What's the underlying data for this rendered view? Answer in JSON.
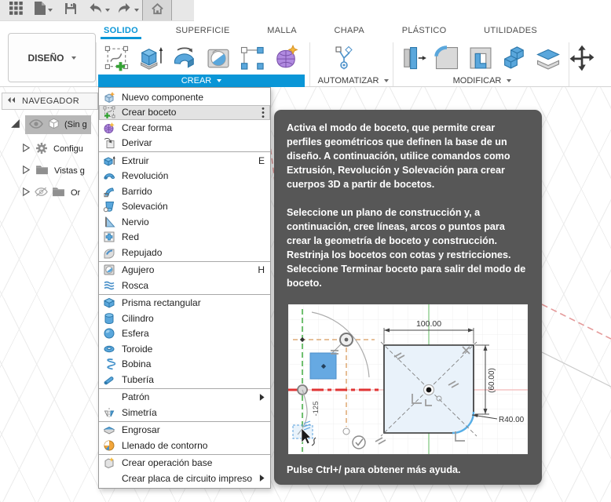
{
  "topbar": {
    "icons": [
      "app-grid",
      "file",
      "save",
      "undo",
      "redo",
      "home"
    ]
  },
  "ribbon": {
    "design_menu": {
      "label": "DISEÑO"
    },
    "tabs": [
      {
        "id": "solido",
        "label": "SOLIDO",
        "active": true
      },
      {
        "id": "superficie",
        "label": "SUPERFICIE",
        "active": false
      },
      {
        "id": "malla",
        "label": "MALLA",
        "active": false
      },
      {
        "id": "chapa",
        "label": "CHAPA",
        "active": false
      },
      {
        "id": "plastico",
        "label": "PLÁSTICO",
        "active": false
      },
      {
        "id": "utilidades",
        "label": "UTILIDADES",
        "active": false
      }
    ],
    "groups": {
      "crear": {
        "label": "CREAR"
      },
      "automatizar": {
        "label": "AUTOMATIZAR"
      },
      "modificar": {
        "label": "MODIFICAR"
      }
    },
    "tools": {
      "crear": [
        "create-sketch",
        "extrude",
        "revolve",
        "hole",
        "pattern",
        "create-form"
      ],
      "automatizar": [
        "scripts"
      ],
      "modificar": [
        "press-pull",
        "fillet",
        "shell",
        "combine",
        "split-body",
        "move-copy"
      ]
    }
  },
  "navigator": {
    "title": "NAVEGADOR",
    "items": [
      {
        "id": "document",
        "label": "(Sin g",
        "selected": true,
        "expanded": true
      },
      {
        "id": "configuracion",
        "label": "Configu",
        "selected": false
      },
      {
        "id": "vistas",
        "label": "Vistas g",
        "selected": false
      },
      {
        "id": "origen",
        "label": "Or",
        "selected": false
      }
    ]
  },
  "menu": {
    "items": [
      {
        "id": "nuevo-componente",
        "label": "Nuevo componente",
        "icon": "new-component"
      },
      {
        "id": "crear-boceto",
        "label": "Crear boceto",
        "icon": "sketch",
        "selected": true,
        "trailing": "kebab"
      },
      {
        "id": "crear-forma",
        "label": "Crear forma",
        "icon": "form"
      },
      {
        "id": "derivar",
        "label": "Derivar",
        "icon": "derive"
      },
      {
        "type": "separator"
      },
      {
        "id": "extruir",
        "label": "Extruir",
        "icon": "extrude-s",
        "shortcut": "E"
      },
      {
        "id": "revolucion",
        "label": "Revolución",
        "icon": "revolve-s"
      },
      {
        "id": "barrido",
        "label": "Barrido",
        "icon": "sweep"
      },
      {
        "id": "solevacion",
        "label": "Solevación",
        "icon": "loft"
      },
      {
        "id": "nervio",
        "label": "Nervio",
        "icon": "rib"
      },
      {
        "id": "red",
        "label": "Red",
        "icon": "web"
      },
      {
        "id": "repujado",
        "label": "Repujado",
        "icon": "emboss"
      },
      {
        "type": "separator"
      },
      {
        "id": "agujero",
        "label": "Agujero",
        "icon": "hole-s",
        "shortcut": "H"
      },
      {
        "id": "rosca",
        "label": "Rosca",
        "icon": "thread"
      },
      {
        "type": "separator"
      },
      {
        "id": "prisma-rectangular",
        "label": "Prisma rectangular",
        "icon": "box"
      },
      {
        "id": "cilindro",
        "label": "Cilindro",
        "icon": "cylinder"
      },
      {
        "id": "esfera",
        "label": "Esfera",
        "icon": "sphere"
      },
      {
        "id": "toroide",
        "label": "Toroide",
        "icon": "torus"
      },
      {
        "id": "bobina",
        "label": "Bobina",
        "icon": "coil"
      },
      {
        "id": "tuberia",
        "label": "Tubería",
        "icon": "pipe"
      },
      {
        "type": "separator"
      },
      {
        "id": "patron",
        "label": "Patrón",
        "submenu": true
      },
      {
        "id": "simetria",
        "label": "Simetría",
        "icon": "mirror"
      },
      {
        "type": "separator"
      },
      {
        "id": "engrosar",
        "label": "Engrosar",
        "icon": "thicken"
      },
      {
        "id": "llenado-de-contorno",
        "label": "Llenado de contorno",
        "icon": "boundary-fill"
      },
      {
        "type": "separator"
      },
      {
        "id": "crear-operacion-base",
        "label": "Crear operación base",
        "icon": "base-feature"
      },
      {
        "id": "crear-placa-de-circuito-impreso",
        "label": "Crear placa de circuito impreso",
        "submenu": true
      }
    ]
  },
  "tooltip": {
    "paragraphs": [
      "Activa el modo de boceto, que permite crear perfiles geométricos que definen la base de un diseño. A continuación, utilice comandos como Extrusión, Revolución y Solevación para crear cuerpos 3D a partir de bocetos.",
      "Seleccione un plano de construcción y, a continuación, cree líneas, arcos o puntos para crear la geometría de boceto y construcción. Restrinja los bocetos con cotas y restricciones. Seleccione Terminar boceto para salir del modo de boceto."
    ],
    "footer": "Pulse Ctrl+/ para obtener más ayuda.",
    "image_labels": {
      "width": "100.00",
      "height": "(60.00)",
      "radius": "R40.00",
      "offset": "-125"
    }
  },
  "colors": {
    "accent": "#0a96d7",
    "tooltip_bg": "#575757",
    "menu_highlight": "#e3e3e3",
    "selection_gray": "#b7b7b7"
  }
}
